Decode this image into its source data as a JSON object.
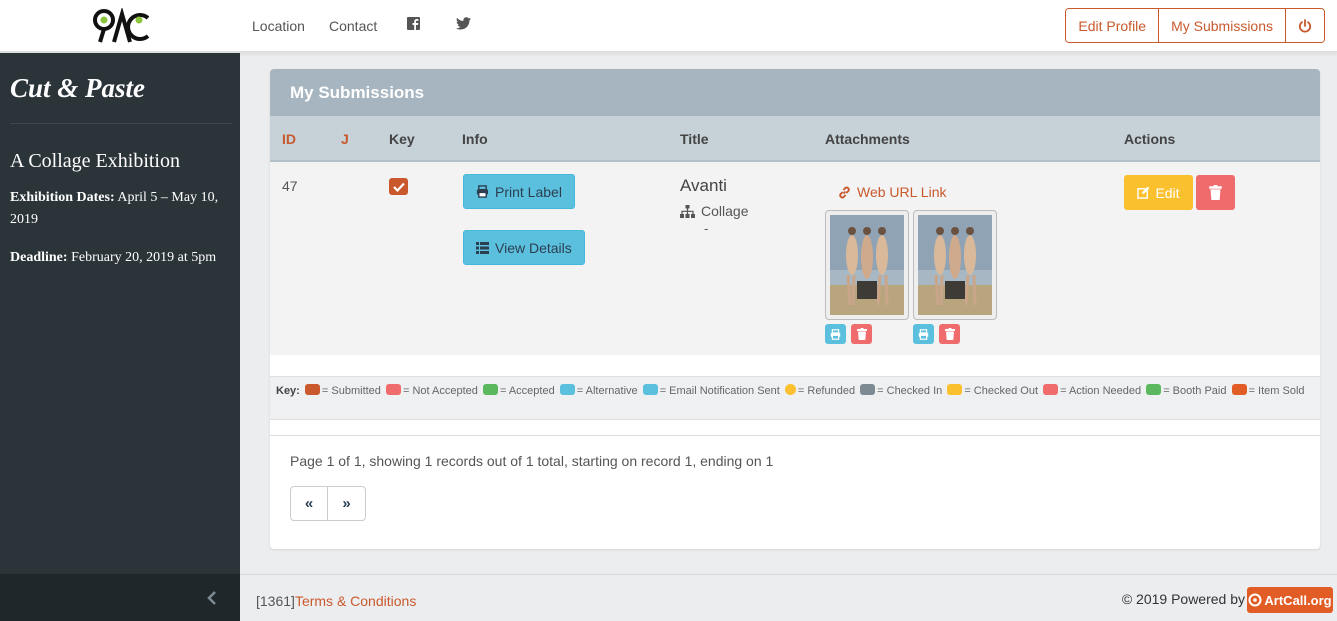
{
  "nav": {
    "logo_text": "AC",
    "links": [
      "Location",
      "Contact"
    ],
    "social": [
      "facebook-icon",
      "twitter-icon"
    ],
    "buttons": {
      "edit_profile": "Edit Profile",
      "my_submissions": "My Submissions"
    }
  },
  "sidebar": {
    "title": "Cut & Paste",
    "subtitle": "A Collage Exhibition",
    "dates_label": "Exhibition Dates:",
    "dates_value": " April 5 – May 10, 2019",
    "deadline_label": "Deadline:",
    "deadline_value": " February 20, 2019 at 5pm"
  },
  "panel": {
    "heading": "My Submissions",
    "columns": {
      "id": "ID",
      "j": "J",
      "key": "Key",
      "info": "Info",
      "title": "Title",
      "attachments": "Attachments",
      "actions": "Actions"
    },
    "row": {
      "id": "47",
      "print_label": "Print Label",
      "view_details": "View Details",
      "title": "Avanti",
      "medium": "Collage",
      "dash": "-",
      "web_link": "Web URL Link",
      "edit": "Edit"
    },
    "key_legend": {
      "label": "Key:",
      "items": [
        "= Submitted",
        "= Not Accepted",
        "= Accepted",
        "= Alternative",
        "= Email Notification Sent",
        "= Refunded",
        "= Checked In",
        "= Checked Out",
        "= Action Needed",
        "= Booth Paid",
        "= Item Sold"
      ]
    },
    "pagination_text": "Page 1 of 1, showing 1 records out of 1 total, starting on record 1, ending on 1",
    "prev": "«",
    "next": "»"
  },
  "footer": {
    "id": "[1361]",
    "terms": "Terms & Conditions",
    "powered": "© 2019 Powered by",
    "brand": "ArtCall.org"
  },
  "colors": {
    "accent": "#c9592d",
    "sidebar": "#2b3439",
    "info_button": "#5bc0de",
    "edit_button": "#fbc02d",
    "delete_button": "#f06b6b"
  }
}
